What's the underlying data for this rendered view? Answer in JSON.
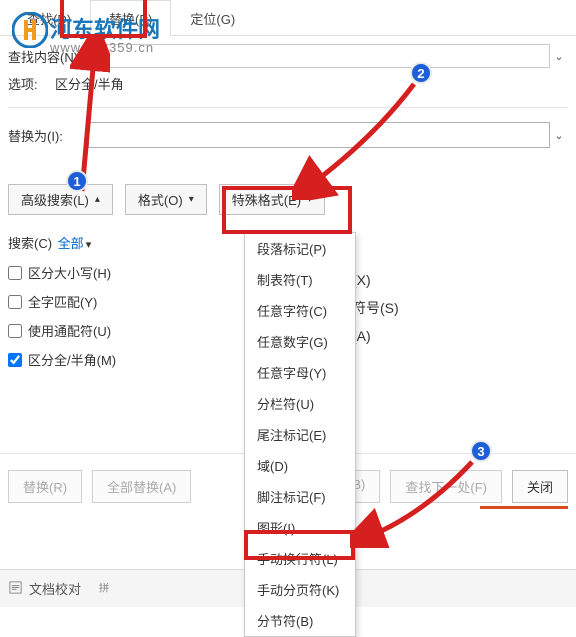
{
  "watermark": {
    "text": "河东软件网",
    "url": "www.pc0359.cn"
  },
  "tabs": {
    "find": "查找(D)",
    "replace": "替换(P)",
    "goto": "定位(G)"
  },
  "findRow": {
    "label": "查找内容(N):"
  },
  "options": {
    "label": "选项:",
    "value": "区分全/半角"
  },
  "replaceRow": {
    "label": "替换为(I):"
  },
  "buttons": {
    "advanced": "高级搜索(L)",
    "format": "格式(O)",
    "special": "特殊格式(E)"
  },
  "search": {
    "label": "搜索(C)",
    "scope": "全部",
    "caret": "▾"
  },
  "checks": {
    "case": "区分大小写(H)",
    "whole": "全字匹配(Y)",
    "wildcard": "使用通配符(U)",
    "width": "区分全/半角(M)"
  },
  "sideLabels": {
    "x": "(X)",
    "symbol": "符号(S)",
    "a": "(A)"
  },
  "special_menu": {
    "para": "段落标记(P)",
    "tab": "制表符(T)",
    "anychar": "任意字符(C)",
    "anydigit": "任意数字(G)",
    "anyletter": "任意字母(Y)",
    "column": "分栏符(U)",
    "endnote": "尾注标记(E)",
    "field": "域(D)",
    "footnote": "脚注标记(F)",
    "graphic": "图形(I)",
    "linebreak": "手动换行符(L)",
    "pagebreak": "手动分页符(K)",
    "section": "分节符(B)"
  },
  "footer": {
    "replace": "替换(R)",
    "replaceAll": "全部替换(A)",
    "findPrev": "(B)",
    "findNext": "查找下一处(F)",
    "close": "关闭"
  },
  "bottomBar": {
    "proofread": "文档校对",
    "pinyin": ""
  }
}
